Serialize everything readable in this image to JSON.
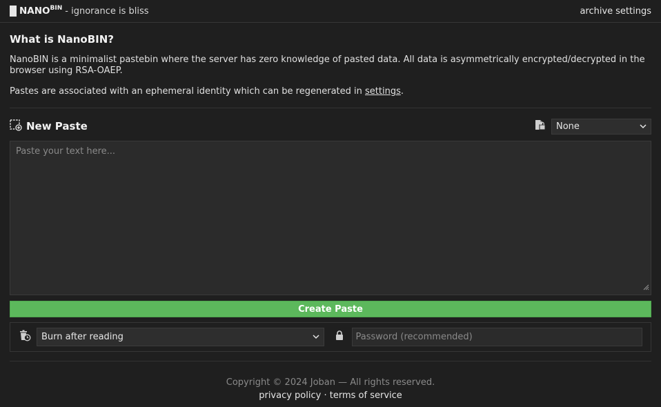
{
  "header": {
    "brand_name": "NANO",
    "brand_sup": "BIN",
    "tagline": "- ignorance is bliss",
    "nav": [
      "archive",
      "settings"
    ]
  },
  "about": {
    "title": "What is NanoBIN?",
    "paragraph1": "NanoBIN is a minimalist pastebin where the server has zero knowledge of pasted data. All data is asymmetrically encrypted/decrypted in the browser using RSA-OAEP.",
    "paragraph2_prefix": "Pastes are associated with an ephemeral identity which can be regenerated in ",
    "paragraph2_link": "settings",
    "paragraph2_suffix": "."
  },
  "new_paste": {
    "title": "New Paste",
    "language_select": "None",
    "textarea_placeholder": "Paste your text here...",
    "create_button": "Create Paste",
    "expiry_select": "Burn after reading",
    "password_placeholder": "Password (recommended)"
  },
  "footer": {
    "copyright": "Copyright © 2024 Joban — All rights reserved.",
    "privacy": "privacy policy",
    "separator": "·",
    "terms": "terms of service"
  },
  "icons": {
    "new_paste": "new-paste-icon",
    "file_type": "file-lock-icon",
    "burn": "burn-timer-icon",
    "lock": "lock-icon"
  },
  "colors": {
    "background": "#1f1f1f",
    "accent_green": "#5cb85c",
    "text": "#e6e6e6",
    "muted": "#8a8a8a"
  }
}
